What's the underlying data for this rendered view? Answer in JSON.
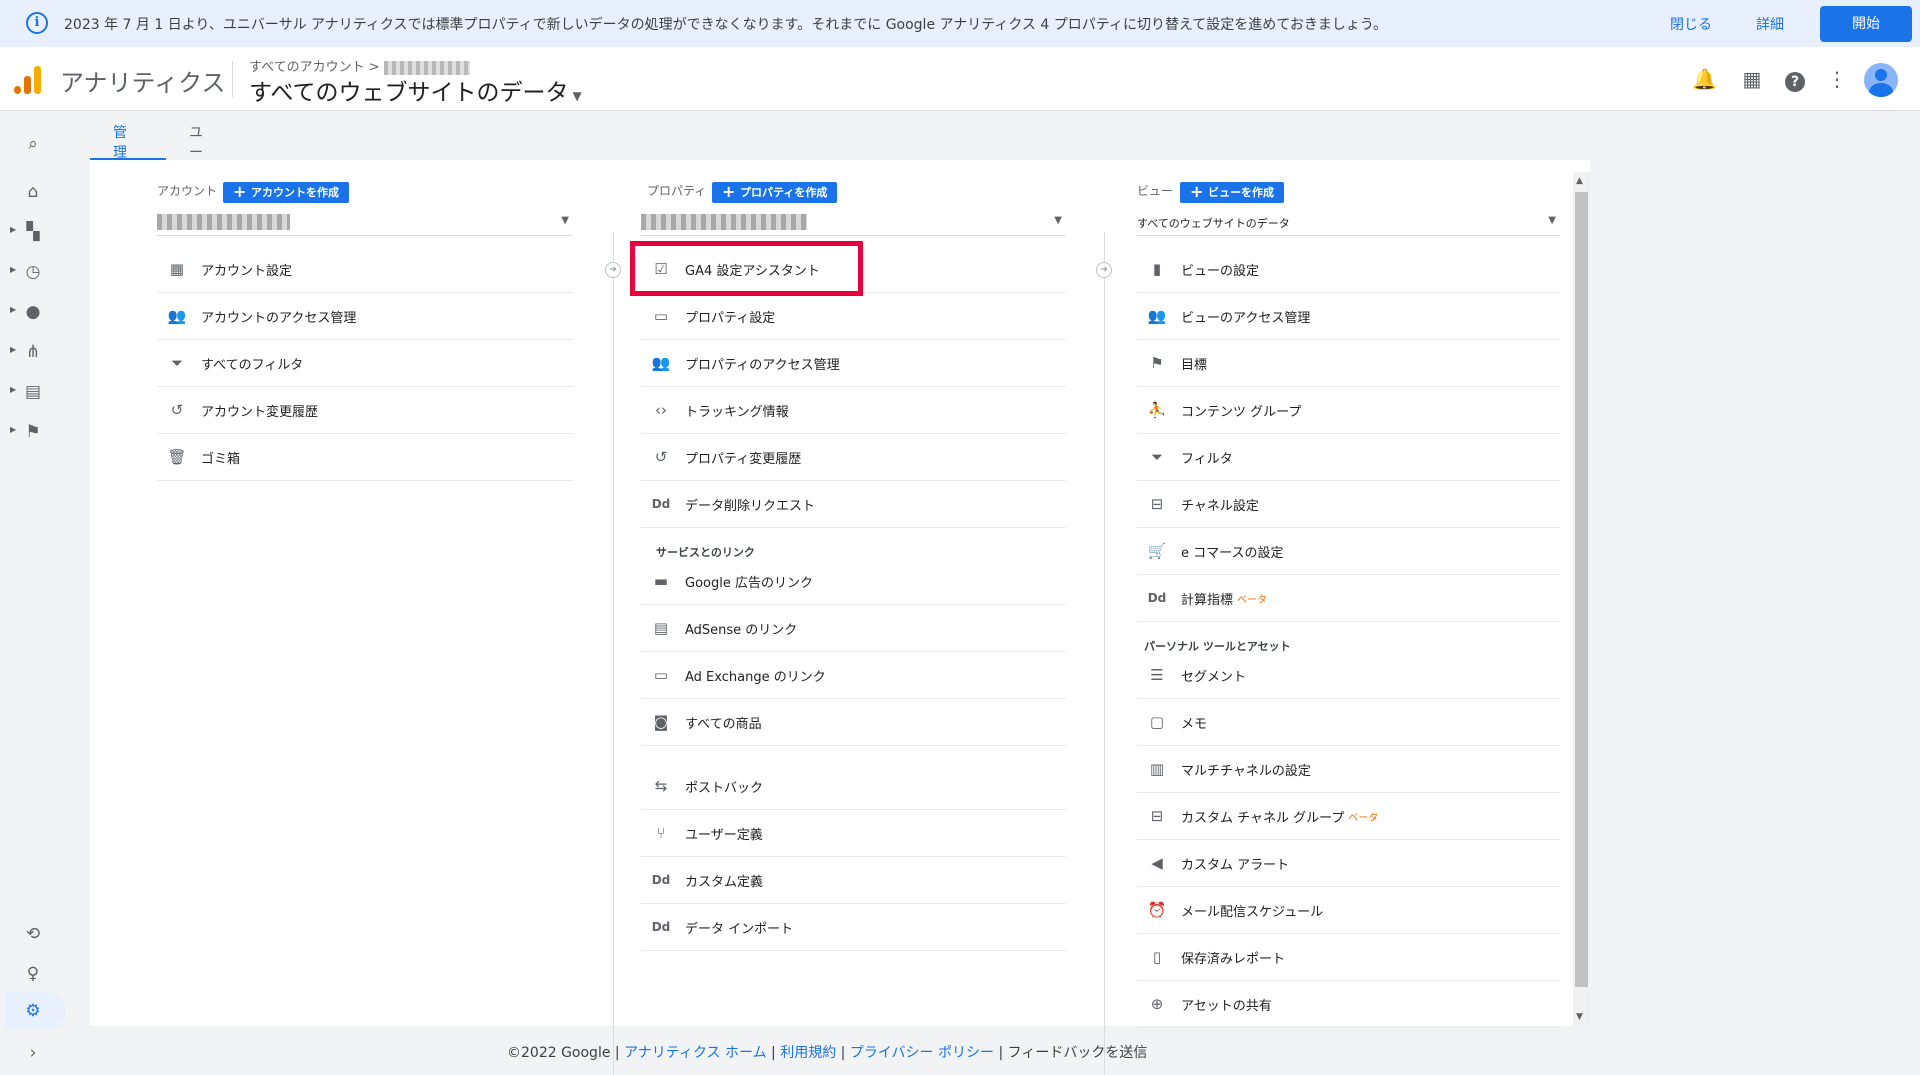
{
  "banner": {
    "message": "2023 年 7 月 1 日より、ユニバーサル アナリティクスでは標準プロパティで新しいデータの処理ができなくなります。それまでに Google アナリティクス 4 プロパティに切り替えて設定を進めておきましょう。",
    "close_label": "閉じる",
    "details_label": "詳細",
    "start_label": "開始"
  },
  "header": {
    "app_name": "アナリティクス",
    "breadcrumb": "すべてのアカウント >",
    "view_title": "すべてのウェブサイトのデータ"
  },
  "tabs": {
    "admin": "管理",
    "user": "ユーザー"
  },
  "account": {
    "heading": "アカウント",
    "create_label": "アカウントを作成",
    "items": [
      {
        "label": "アカウント設定",
        "icon": "building-icon"
      },
      {
        "label": "アカウントのアクセス管理",
        "icon": "people-icon"
      },
      {
        "label": "すべてのフィルタ",
        "icon": "filter-icon"
      },
      {
        "label": "アカウント変更履歴",
        "icon": "history-icon"
      },
      {
        "label": "ゴミ箱",
        "icon": "trash-icon"
      }
    ]
  },
  "property": {
    "heading": "プロパティ",
    "create_label": "プロパティを作成",
    "items": [
      {
        "label": "GA4 設定アシスタント",
        "icon": "checkbox-icon"
      },
      {
        "label": "プロパティ設定",
        "icon": "layout-icon"
      },
      {
        "label": "プロパティのアクセス管理",
        "icon": "people-icon"
      },
      {
        "label": "トラッキング情報",
        "icon": "code-icon"
      },
      {
        "label": "プロパティ変更履歴",
        "icon": "history-icon"
      },
      {
        "label": "データ削除リクエスト",
        "icon": "dd-icon"
      }
    ],
    "section_links": "サービスとのリンク",
    "links": [
      {
        "label": "Google 広告のリンク",
        "icon": "ads-icon"
      },
      {
        "label": "AdSense のリンク",
        "icon": "adsense-icon"
      },
      {
        "label": "Ad Exchange のリンク",
        "icon": "adx-icon"
      },
      {
        "label": "すべての商品",
        "icon": "products-icon"
      }
    ],
    "more": [
      {
        "label": "ポストバック",
        "icon": "swap-icon"
      },
      {
        "label": "ユーザー定義",
        "icon": "fork-icon"
      },
      {
        "label": "カスタム定義",
        "icon": "dd-icon"
      },
      {
        "label": "データ インポート",
        "icon": "dd-icon"
      }
    ]
  },
  "view": {
    "heading": "ビュー",
    "create_label": "ビューを作成",
    "selected": "すべてのウェブサイトのデータ",
    "items": [
      {
        "label": "ビューの設定",
        "icon": "doc-icon"
      },
      {
        "label": "ビューのアクセス管理",
        "icon": "people-icon"
      },
      {
        "label": "目標",
        "icon": "flag-icon"
      },
      {
        "label": "コンテンツ グループ",
        "icon": "person-walk-icon"
      },
      {
        "label": "フィルタ",
        "icon": "filter-icon"
      },
      {
        "label": "チャネル設定",
        "icon": "channel-icon"
      },
      {
        "label": "e コマースの設定",
        "icon": "cart-icon"
      },
      {
        "label": "計算指標",
        "icon": "dd-icon",
        "beta": "ベータ"
      }
    ],
    "section_personal": "パーソナル ツールとアセット",
    "personal": [
      {
        "label": "セグメント",
        "icon": "segment-icon"
      },
      {
        "label": "メモ",
        "icon": "memo-icon"
      },
      {
        "label": "マルチチャネルの設定",
        "icon": "bars-icon"
      },
      {
        "label": "カスタム チャネル グループ",
        "icon": "channel-icon",
        "beta": "ベータ"
      },
      {
        "label": "カスタム アラート",
        "icon": "megaphone-icon"
      },
      {
        "label": "メール配信スケジュール",
        "icon": "alarm-icon"
      },
      {
        "label": "保存済みレポート",
        "icon": "pages-icon"
      },
      {
        "label": "アセットの共有",
        "icon": "person-add-icon"
      }
    ]
  },
  "footer": {
    "copyright": "©2022 Google |",
    "home": "アナリティクス ホーム",
    "terms": "利用規約",
    "privacy": "プライバシー ポリシー",
    "feedback": "フィードバックを送信",
    "sep": "|"
  }
}
